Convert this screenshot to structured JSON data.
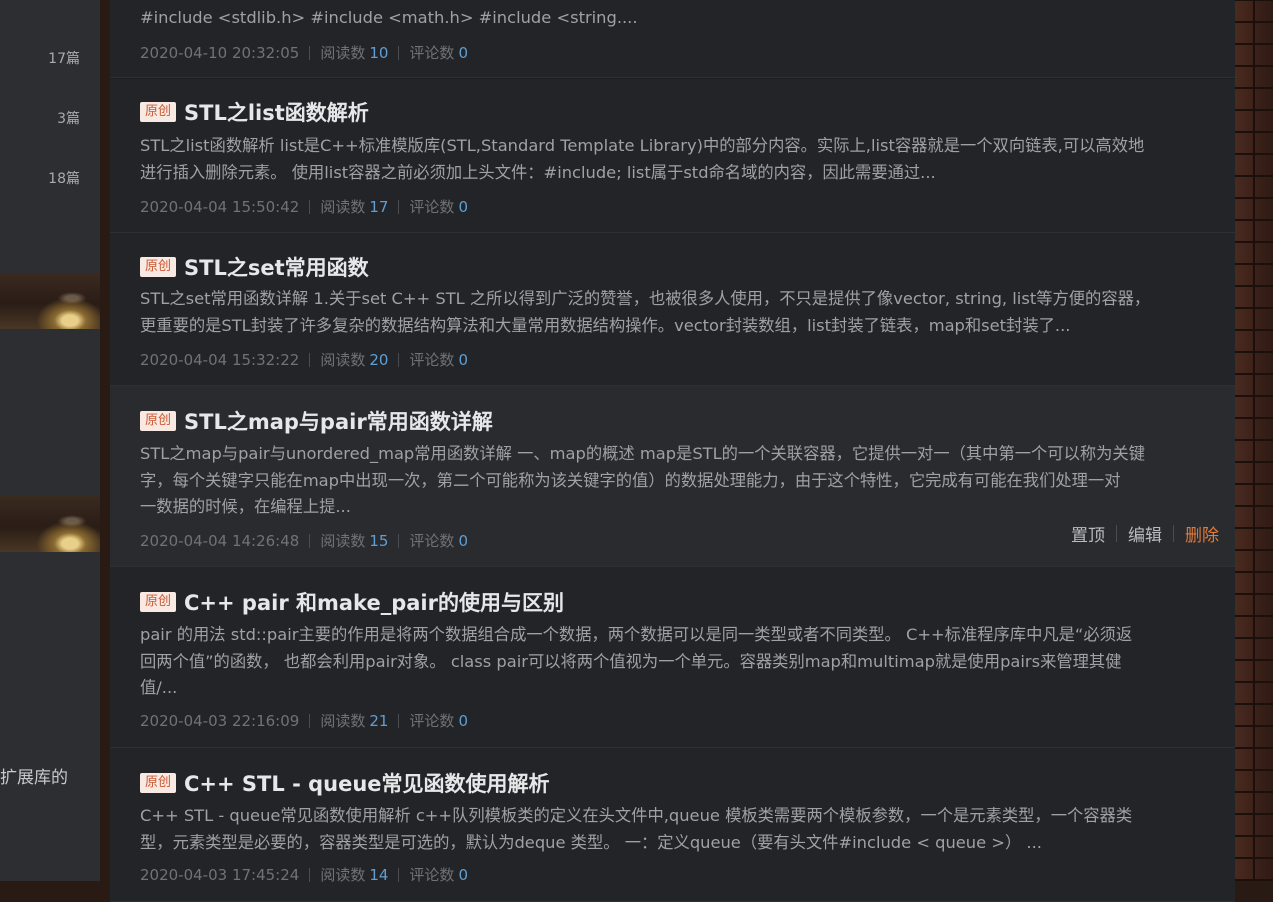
{
  "sidebar": {
    "counts": [
      "17篇",
      "3篇",
      "18篇"
    ],
    "snippet": "扩展库的"
  },
  "articles": [
    {
      "summary": [
        "#include <stdlib.h> #include <math.h> #include <string...."
      ],
      "date": "2020-04-10 20:32:05",
      "read_label": "阅读数",
      "reads": "10",
      "comment_label": "评论数",
      "comments": "0"
    },
    {
      "badge": "原创",
      "title": "STL之list函数解析",
      "summary": [
        "STL之list函数解析 list是C++标准模版库(STL,Standard Template Library)中的部分内容。实际上,list容器就是一个双向链表,可以高效地",
        "进行插入删除元素。 使用list容器之前必须加上头文件：#include; list属于std命名域的内容，因此需要通过..."
      ],
      "date": "2020-04-04 15:50:42",
      "read_label": "阅读数",
      "reads": "17",
      "comment_label": "评论数",
      "comments": "0"
    },
    {
      "badge": "原创",
      "title": "STL之set常用函数",
      "summary": [
        "STL之set常用函数详解 1.关于set C++ STL 之所以得到广泛的赞誉，也被很多人使用，不只是提供了像vector, string, list等方便的容器，",
        "更重要的是STL封装了许多复杂的数据结构算法和大量常用数据结构操作。vector封装数组，list封装了链表，map和set封装了..."
      ],
      "date": "2020-04-04 15:32:22",
      "read_label": "阅读数",
      "reads": "20",
      "comment_label": "评论数",
      "comments": "0"
    },
    {
      "badge": "原创",
      "title": "STL之map与pair常用函数详解",
      "summary": [
        "STL之map与pair与unordered_map常用函数详解 一、map的概述 map是STL的一个关联容器，它提供一对一（其中第一个可以称为关键",
        "字，每个关键字只能在map中出现一次，第二个可能称为该关键字的值）的数据处理能力，由于这个特性，它完成有可能在我们处理一对",
        "一数据的时候，在编程上提..."
      ],
      "date": "2020-04-04 14:26:48",
      "read_label": "阅读数",
      "reads": "15",
      "comment_label": "评论数",
      "comments": "0",
      "actions": {
        "pin": "置顶",
        "edit": "编辑",
        "delete": "删除"
      }
    },
    {
      "badge": "原创",
      "title": "C++ pair 和make_pair的使用与区别",
      "summary": [
        "pair 的用法 std::pair主要的作用是将两个数据组合成一个数据，两个数据可以是同一类型或者不同类型。 C++标准程序库中凡是“必须返",
        "回两个值”的函数， 也都会利用pair对象。 class pair可以将两个值视为一个单元。容器类别map和multimap就是使用pairs来管理其健",
        "值/..."
      ],
      "date": "2020-04-03 22:16:09",
      "read_label": "阅读数",
      "reads": "21",
      "comment_label": "评论数",
      "comments": "0"
    },
    {
      "badge": "原创",
      "title": "C++ STL - queue常见函数使用解析",
      "summary": [
        "C++ STL - queue常见函数使用解析 c++队列模板类的定义在头文件中,queue 模板类需要两个模板参数，一个是元素类型，一个容器类",
        "型，元素类型是必要的，容器类型是可选的，默认为deque 类型。 一：定义queue（要有头文件#include < queue >） ..."
      ],
      "date": "2020-04-03 17:45:24",
      "read_label": "阅读数",
      "reads": "14",
      "comment_label": "评论数",
      "comments": "0"
    }
  ]
}
